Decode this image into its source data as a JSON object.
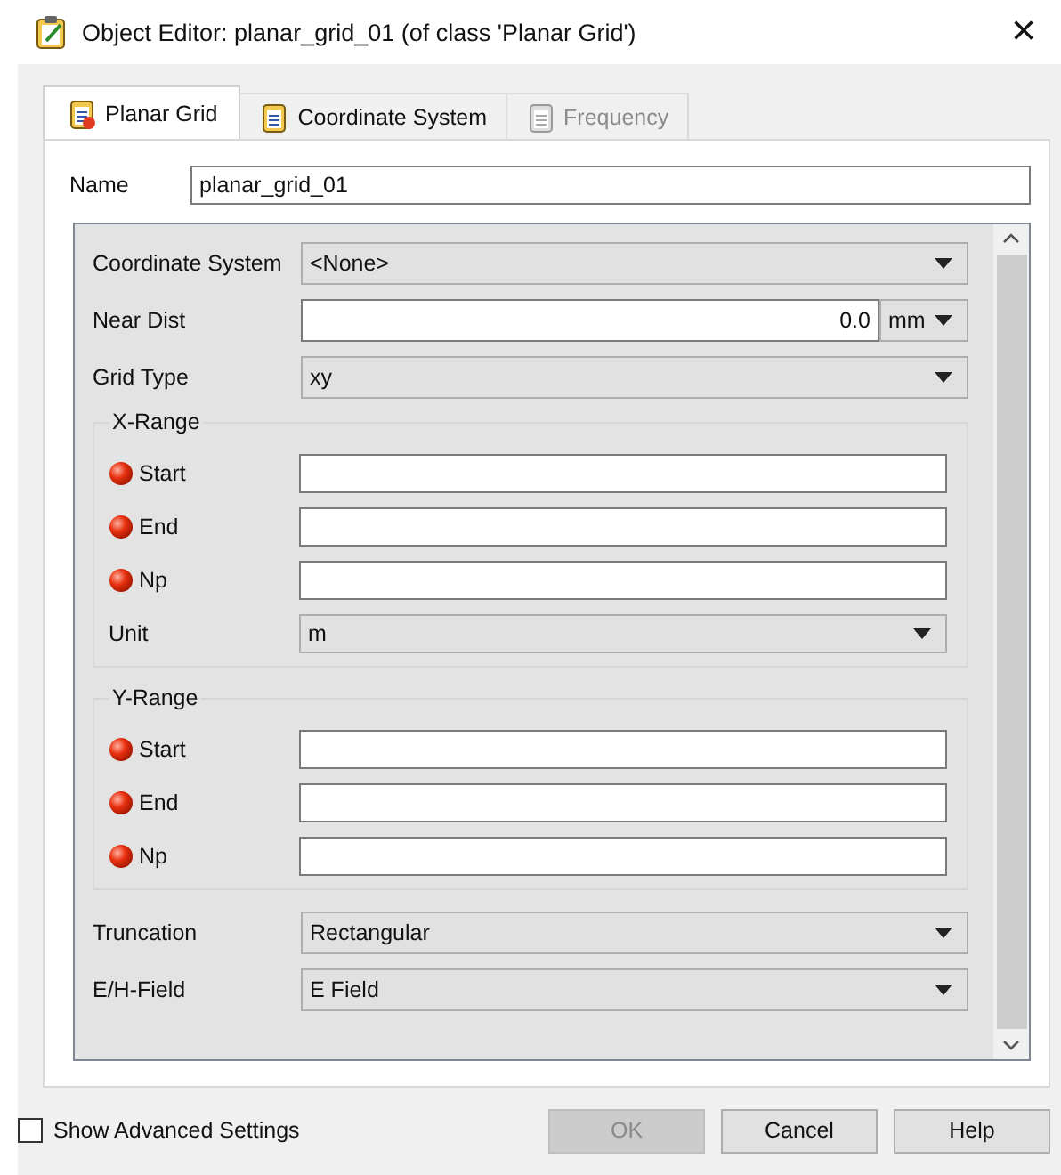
{
  "window": {
    "title": "Object Editor: planar_grid_01 (of class 'Planar Grid')",
    "close": "×"
  },
  "tabs": [
    {
      "label": "Planar Grid",
      "selected": true,
      "disabled": false
    },
    {
      "label": "Coordinate System",
      "selected": false,
      "disabled": false
    },
    {
      "label": "Frequency",
      "selected": false,
      "disabled": true
    }
  ],
  "name": {
    "label": "Name",
    "value": "planar_grid_01"
  },
  "sections": [
    {
      "kind": "combo",
      "label": "Coordinate System",
      "value": "<None>"
    },
    {
      "kind": "number",
      "label": "Near Dist",
      "value": "0.0",
      "unit": "mm"
    },
    {
      "kind": "combo",
      "label": "Grid Type",
      "value": "xy"
    },
    {
      "kind": "group",
      "title": "X-Range",
      "rows": [
        {
          "kind": "entry",
          "label": "Start",
          "required": true
        },
        {
          "kind": "entry",
          "label": "End",
          "required": true
        },
        {
          "kind": "entry",
          "label": "Np",
          "required": true
        },
        {
          "kind": "combo",
          "label": "Unit",
          "value": "m"
        }
      ]
    },
    {
      "kind": "group",
      "title": "Y-Range",
      "rows": [
        {
          "kind": "entry",
          "label": "Start",
          "required": true
        },
        {
          "kind": "entry",
          "label": "End",
          "required": true
        },
        {
          "kind": "entry",
          "label": "Np",
          "required": true
        }
      ]
    },
    {
      "kind": "combo",
      "label": "Truncation",
      "value": "Rectangular"
    },
    {
      "kind": "combo",
      "label": "E/H-Field",
      "value": "E Field"
    }
  ],
  "advanced": {
    "label": "Show Advanced Settings",
    "checked": false
  },
  "buttons": [
    {
      "label": "OK",
      "disabled": true
    },
    {
      "label": "Cancel",
      "disabled": false
    },
    {
      "label": "Help",
      "disabled": false
    }
  ]
}
